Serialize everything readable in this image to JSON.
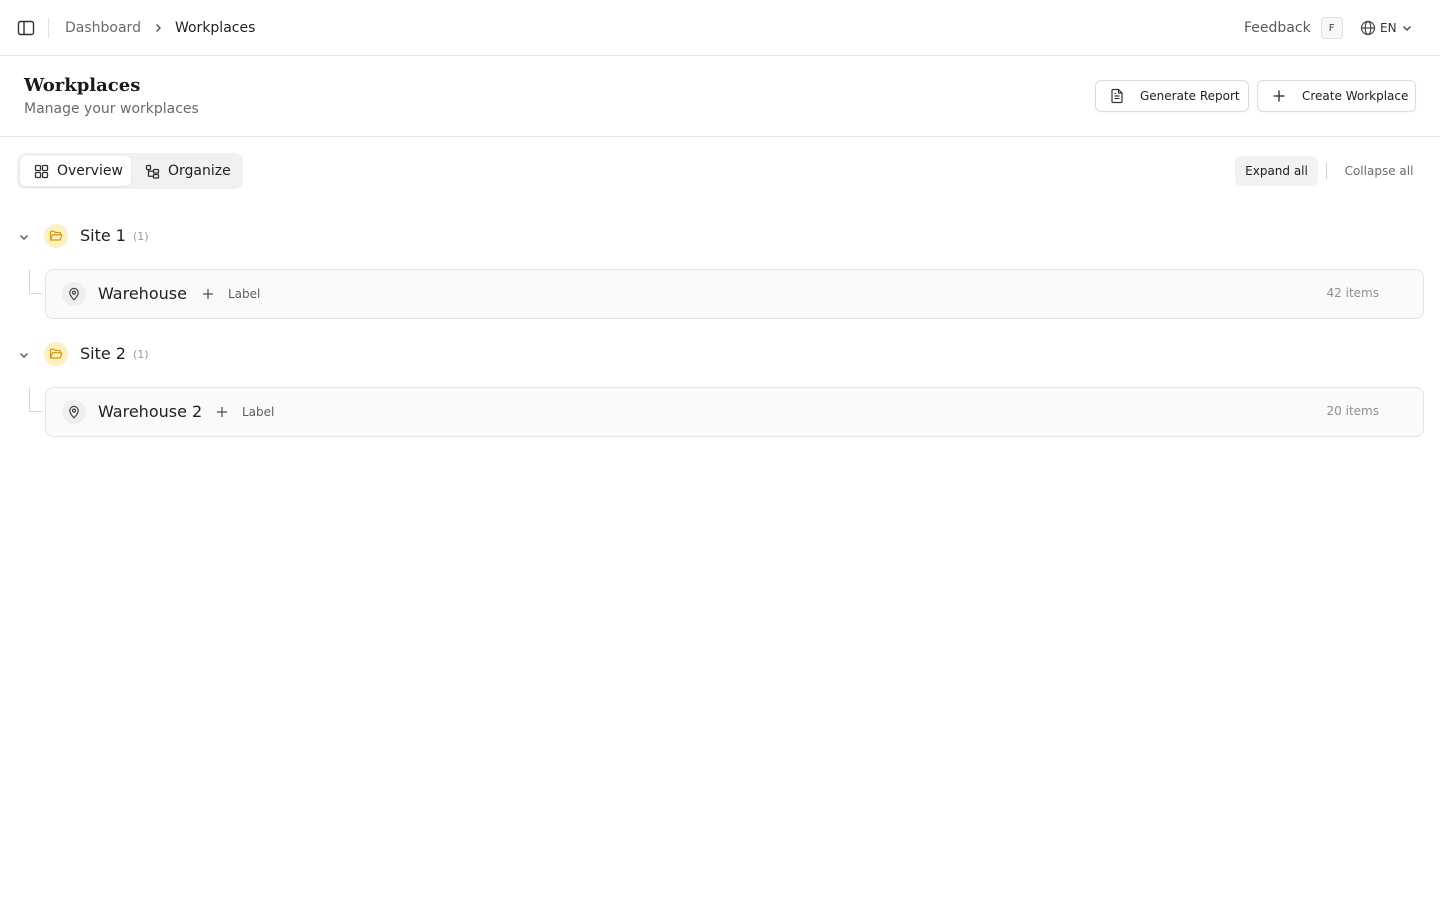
{
  "topbar": {
    "breadcrumb": [
      "Dashboard",
      "Workplaces"
    ],
    "feedback_label": "Feedback",
    "feedback_shortcut": "F",
    "language": "EN"
  },
  "header": {
    "title": "Workplaces",
    "subtitle": "Manage your workplaces",
    "generate_report_label": "Generate Report",
    "create_workplace_label": "Create Workplace"
  },
  "toolbar": {
    "tabs": [
      {
        "label": "Overview",
        "icon": "grid-icon",
        "selected": true
      },
      {
        "label": "Organize",
        "icon": "tree-icon",
        "selected": false
      }
    ],
    "expand_all_label": "Expand all",
    "collapse_all_label": "Collapse all"
  },
  "groups": [
    {
      "name": "Site 1",
      "count": "(1)",
      "icon": "folder-open-icon",
      "workplaces": [
        {
          "name": "Warehouse",
          "add_label": "Label",
          "items": "42 items",
          "icon": "map-pin-icon"
        }
      ]
    },
    {
      "name": "Site 2",
      "count": "(1)",
      "icon": "folder-open-icon",
      "workplaces": [
        {
          "name": "Warehouse 2",
          "add_label": "Label",
          "items": "20 items",
          "icon": "map-pin-icon"
        }
      ]
    }
  ],
  "colors": {
    "folder_badge": "#fdf0c4",
    "folder_icon": "#d19a0f",
    "border": "#e6e6e6"
  }
}
